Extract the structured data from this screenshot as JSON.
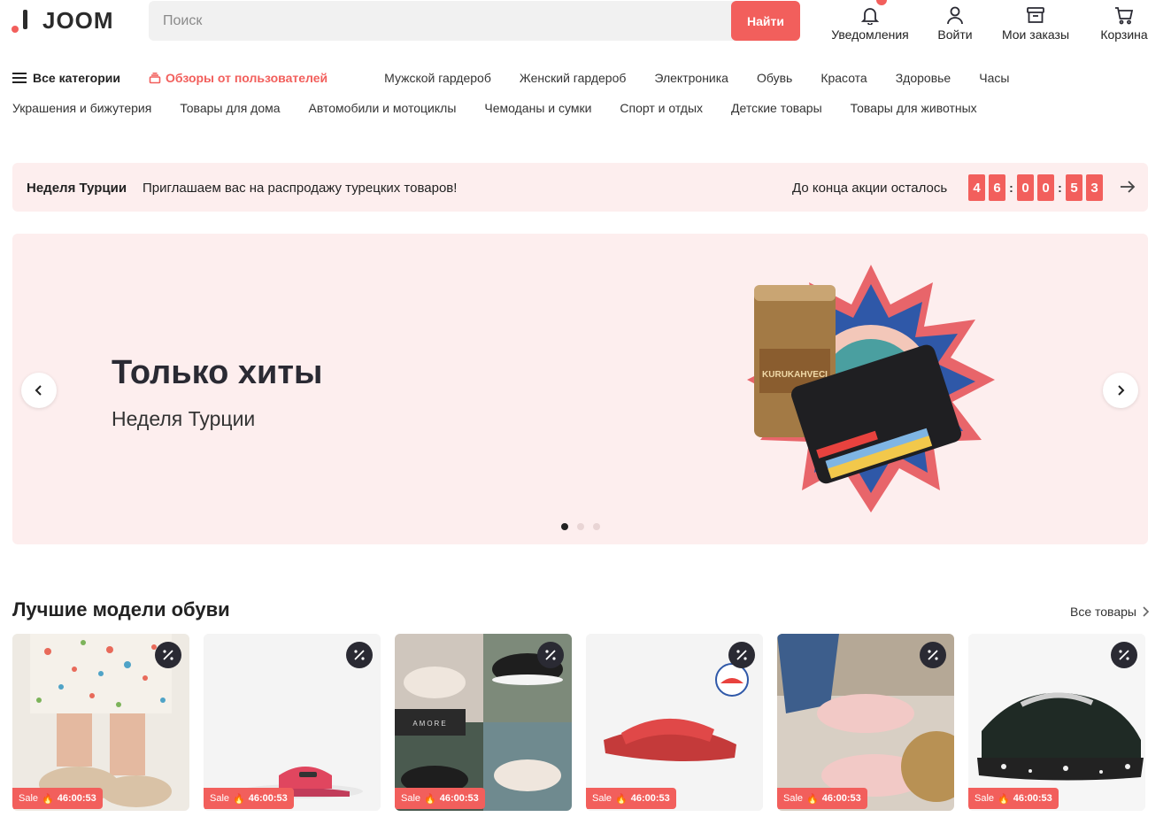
{
  "header": {
    "logo_text": "JOOM",
    "search_placeholder": "Поиск",
    "search_button": "Найти",
    "actions": [
      {
        "label": "Уведомления",
        "icon": "bell-icon"
      },
      {
        "label": "Войти",
        "icon": "user-icon"
      },
      {
        "label": "Мои заказы",
        "icon": "orders-box-icon"
      },
      {
        "label": "Корзина",
        "icon": "cart-icon"
      }
    ]
  },
  "categories": {
    "all_label": "Все категории",
    "reviews_label": "Обзоры от пользователей",
    "row1": [
      "Мужской гардероб",
      "Женский гардероб",
      "Электроника",
      "Обувь",
      "Красота",
      "Здоровье",
      "Часы"
    ],
    "row2": [
      "Украшения и бижутерия",
      "Товары для дома",
      "Автомобили и мотоциклы",
      "Чемоданы и сумки",
      "Спорт и отдых",
      "Детские товары",
      "Товары для животных"
    ]
  },
  "promo": {
    "title": "Неделя Турции",
    "subtitle": "Приглашаем вас на распродажу турецких товаров!",
    "countdown_label": "До конца акции осталось",
    "timer_digits": [
      "4",
      "6",
      "0",
      "0",
      "5",
      "3"
    ]
  },
  "hero": {
    "title": "Только хиты",
    "subtitle": "Неделя Турции",
    "active_slide": 1,
    "slide_count": 3
  },
  "section": {
    "title": "Лучшие модели обуви",
    "all_link": "Все товары"
  },
  "products": [
    {
      "sale_label": "Sale",
      "timer": "46:00:53",
      "image": "braided-sandals"
    },
    {
      "sale_label": "Sale",
      "timer": "46:00:53",
      "image": "pink-slide-sandal"
    },
    {
      "sale_label": "Sale",
      "timer": "46:00:53",
      "image": "sneakers-collage"
    },
    {
      "sale_label": "Sale",
      "timer": "46:00:53",
      "image": "red-slide-sandal"
    },
    {
      "sale_label": "Sale",
      "timer": "46:00:53",
      "image": "pink-sneakers"
    },
    {
      "sale_label": "Sale",
      "timer": "46:00:53",
      "image": "black-chunky-sneaker"
    }
  ],
  "colors": {
    "accent": "#f25f5c",
    "promo_bg": "#fdeeee",
    "dark": "#2a2a33"
  }
}
